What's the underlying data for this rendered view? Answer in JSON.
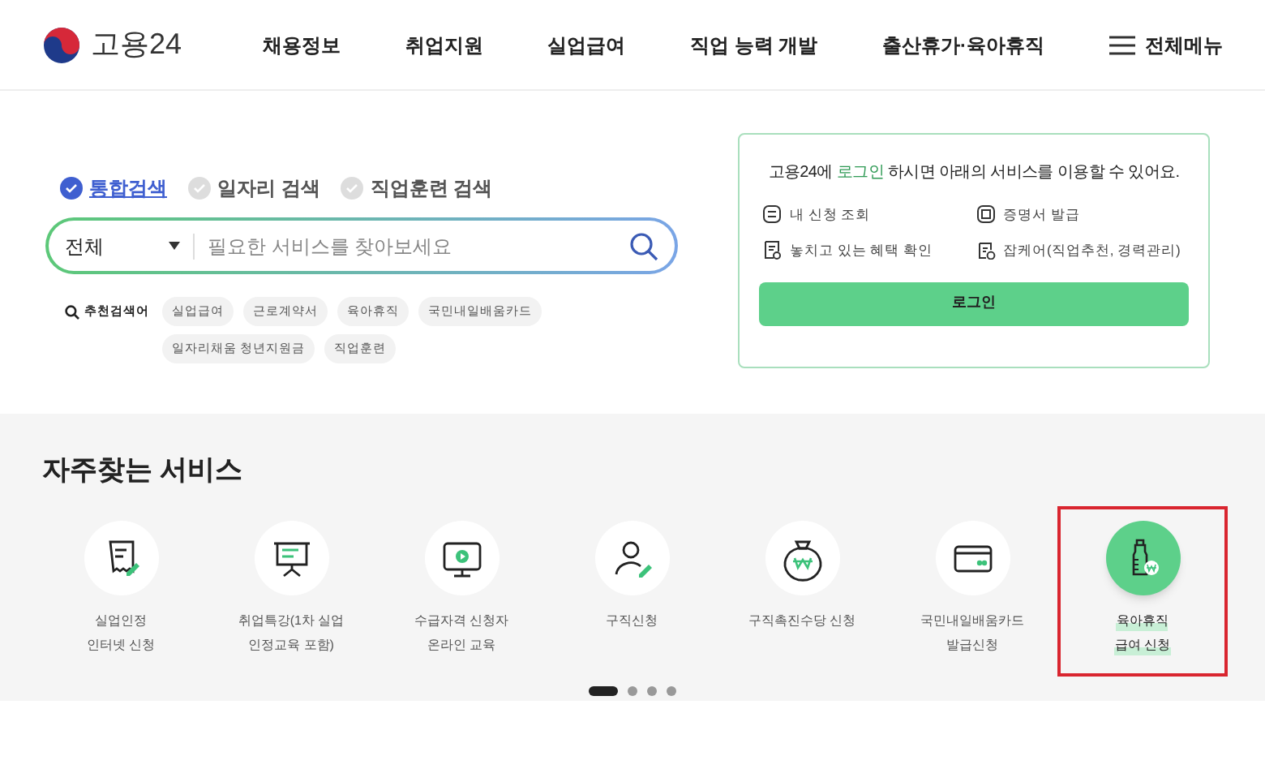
{
  "header": {
    "logo": "고용24",
    "nav": [
      "채용정보",
      "취업지원",
      "실업급여",
      "직업 능력 개발",
      "출산휴가·육아휴직"
    ],
    "menu": "전체메뉴"
  },
  "search": {
    "tabs": [
      {
        "label": "통합검색",
        "selected": true
      },
      {
        "label": "일자리 검색",
        "selected": false
      },
      {
        "label": "직업훈련 검색",
        "selected": false
      }
    ],
    "category": "전체",
    "placeholder": "필요한 서비스를 찾아보세요",
    "recommend_label": "추천검색어",
    "tags": [
      "실업급여",
      "근로계약서",
      "육아휴직",
      "국민내일배움카드",
      "일자리채움 청년지원금",
      "직업훈련"
    ]
  },
  "login_card": {
    "message": "고용24에 **로그인** 하시면 아래의 서비스를 이용할 수 있어요.",
    "services": [
      {
        "label": "내 신청 조회",
        "kind": "list"
      },
      {
        "label": "증명서 발급",
        "kind": "certificate"
      },
      {
        "label": "놓치고 있는 혜택 확인",
        "kind": "document"
      },
      {
        "label": "잡케어(직업추천, 경력관리)",
        "kind": "career"
      }
    ],
    "button": "로그인"
  },
  "frequent": {
    "title": "자주찾는 서비스",
    "items": [
      {
        "lines": [
          "실업인정",
          "인터넷 신청"
        ],
        "kind": "receipt",
        "selected": false
      },
      {
        "lines": [
          "취업특강(1차 실업",
          "인정교육 포함)"
        ],
        "kind": "lecture",
        "selected": false
      },
      {
        "lines": [
          "수급자격 신청자",
          "온라인 교육"
        ],
        "kind": "monitor",
        "selected": false
      },
      {
        "lines": [
          "구직신청"
        ],
        "kind": "person",
        "selected": false
      },
      {
        "lines": [
          "구직촉진수당 신청"
        ],
        "kind": "moneybag",
        "selected": false
      },
      {
        "lines": [
          "국민내일배움카드",
          "발급신청"
        ],
        "kind": "card",
        "selected": false
      },
      {
        "lines": [
          "육아휴직",
          "급여 신청"
        ],
        "kind": "bottle",
        "selected": true
      }
    ],
    "pages": [
      {
        "selected": true
      },
      {
        "selected": false
      },
      {
        "selected": false
      },
      {
        "selected": false
      }
    ]
  }
}
